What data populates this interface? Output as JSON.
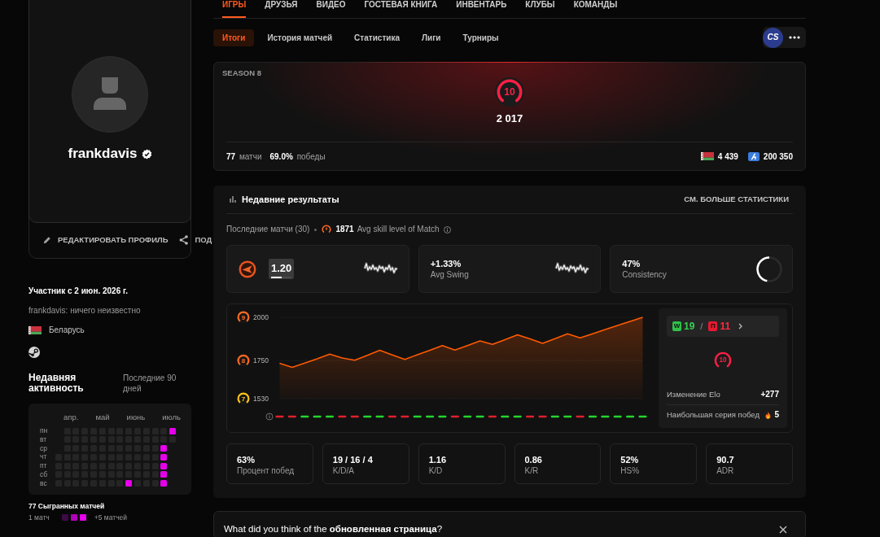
{
  "nav": [
    {
      "label": "ИГРЫ",
      "selected": true
    },
    {
      "label": "ДРУЗЬЯ",
      "selected": false
    },
    {
      "label": "ВИДЕО",
      "selected": false
    },
    {
      "label": "ГОСТЕВАЯ КНИГА",
      "selected": false
    },
    {
      "label": "ИНВЕНТАРЬ",
      "selected": false
    },
    {
      "label": "КЛУБЫ",
      "selected": false
    },
    {
      "label": "КОМАНДЫ",
      "selected": false
    }
  ],
  "profile": {
    "username": "frankdavis",
    "verified": true,
    "actions": [
      {
        "kind": "edit",
        "label": "РЕДАКТИРОВАТЬ ПРОФИЛЬ"
      },
      {
        "kind": "share",
        "label": "ПОД"
      }
    ]
  },
  "about": {
    "member_since": "Участник с 2 июн. 2026 г.",
    "bio": "frankdavis: ничего неизвестно",
    "country": "Беларусь"
  },
  "activity": {
    "title": "Недавняя активность",
    "period": "Последние 90 дней",
    "months": [
      "апр.",
      "май",
      "июнь",
      "июль"
    ],
    "rows": [
      {
        "day": "пн",
        "cells": [
          {
            "kind": "blank"
          },
          {
            "kind": "day",
            "active": false
          },
          {
            "kind": "day",
            "active": false
          },
          {
            "kind": "day",
            "active": false
          },
          {
            "kind": "day",
            "active": false
          },
          {
            "kind": "day",
            "active": false
          },
          {
            "kind": "day",
            "active": false
          },
          {
            "kind": "day",
            "active": false
          },
          {
            "kind": "day",
            "active": false
          },
          {
            "kind": "day",
            "active": false
          },
          {
            "kind": "day",
            "active": false
          },
          {
            "kind": "day",
            "active": false
          },
          {
            "kind": "day",
            "active": false
          },
          {
            "kind": "day",
            "active": true
          }
        ]
      },
      {
        "day": "вт",
        "cells": [
          {
            "kind": "blank"
          },
          {
            "kind": "day",
            "active": false
          },
          {
            "kind": "day",
            "active": false
          },
          {
            "kind": "day",
            "active": false
          },
          {
            "kind": "day",
            "active": false
          },
          {
            "kind": "day",
            "active": false
          },
          {
            "kind": "day",
            "active": false
          },
          {
            "kind": "day",
            "active": false
          },
          {
            "kind": "day",
            "active": false
          },
          {
            "kind": "day",
            "active": false
          },
          {
            "kind": "day",
            "active": false
          },
          {
            "kind": "day",
            "active": false
          },
          {
            "kind": "day",
            "active": false
          },
          {
            "kind": "day",
            "active": false
          }
        ]
      },
      {
        "day": "ср",
        "cells": [
          {
            "kind": "blank"
          },
          {
            "kind": "day",
            "active": false
          },
          {
            "kind": "day",
            "active": false
          },
          {
            "kind": "day",
            "active": false
          },
          {
            "kind": "day",
            "active": false
          },
          {
            "kind": "day",
            "active": false
          },
          {
            "kind": "day",
            "active": false
          },
          {
            "kind": "day",
            "active": false
          },
          {
            "kind": "day",
            "active": false
          },
          {
            "kind": "day",
            "active": false
          },
          {
            "kind": "day",
            "active": false
          },
          {
            "kind": "day",
            "active": false
          },
          {
            "kind": "day",
            "active": true
          },
          {
            "kind": "blank"
          }
        ]
      },
      {
        "day": "чт",
        "cells": [
          {
            "kind": "day",
            "active": false
          },
          {
            "kind": "day",
            "active": false
          },
          {
            "kind": "day",
            "active": false
          },
          {
            "kind": "day",
            "active": false
          },
          {
            "kind": "day",
            "active": false
          },
          {
            "kind": "day",
            "active": false
          },
          {
            "kind": "day",
            "active": false
          },
          {
            "kind": "day",
            "active": false
          },
          {
            "kind": "day",
            "active": false
          },
          {
            "kind": "day",
            "active": false
          },
          {
            "kind": "day",
            "active": false
          },
          {
            "kind": "day",
            "active": false
          },
          {
            "kind": "day",
            "active": true
          },
          {
            "kind": "blank"
          }
        ]
      },
      {
        "day": "пт",
        "cells": [
          {
            "kind": "day",
            "active": false
          },
          {
            "kind": "day",
            "active": false
          },
          {
            "kind": "day",
            "active": false
          },
          {
            "kind": "day",
            "active": false
          },
          {
            "kind": "day",
            "active": false
          },
          {
            "kind": "day",
            "active": false
          },
          {
            "kind": "day",
            "active": false
          },
          {
            "kind": "day",
            "active": false
          },
          {
            "kind": "day",
            "active": false
          },
          {
            "kind": "day",
            "active": false
          },
          {
            "kind": "day",
            "active": false
          },
          {
            "kind": "day",
            "active": false
          },
          {
            "kind": "day",
            "active": true
          },
          {
            "kind": "blank"
          }
        ]
      },
      {
        "day": "сб",
        "cells": [
          {
            "kind": "day",
            "active": false
          },
          {
            "kind": "day",
            "active": false
          },
          {
            "kind": "day",
            "active": false
          },
          {
            "kind": "day",
            "active": false
          },
          {
            "kind": "day",
            "active": false
          },
          {
            "kind": "day",
            "active": false
          },
          {
            "kind": "day",
            "active": false
          },
          {
            "kind": "day",
            "active": false
          },
          {
            "kind": "day",
            "active": false
          },
          {
            "kind": "day",
            "active": false
          },
          {
            "kind": "day",
            "active": false
          },
          {
            "kind": "day",
            "active": false
          },
          {
            "kind": "day",
            "active": true
          },
          {
            "kind": "blank"
          }
        ]
      },
      {
        "day": "вс",
        "cells": [
          {
            "kind": "day",
            "active": false
          },
          {
            "kind": "day",
            "active": false
          },
          {
            "kind": "day",
            "active": false
          },
          {
            "kind": "day",
            "active": false
          },
          {
            "kind": "day",
            "active": false
          },
          {
            "kind": "day",
            "active": false
          },
          {
            "kind": "day",
            "active": false
          },
          {
            "kind": "day",
            "active": false
          },
          {
            "kind": "day",
            "active": true
          },
          {
            "kind": "day",
            "active": false
          },
          {
            "kind": "day",
            "active": false
          },
          {
            "kind": "day",
            "active": false
          },
          {
            "kind": "day",
            "active": true
          },
          {
            "kind": "blank"
          }
        ]
      }
    ],
    "total": "77 Сыгранных матчей",
    "legend": {
      "min": "1 матч",
      "max": "+5 матчей",
      "swatches": [
        {
          "color": "#3c0a44"
        },
        {
          "color": "#b000b8"
        },
        {
          "color": "#e600eb"
        }
      ]
    }
  },
  "subtabs": [
    {
      "label": "Итоги",
      "selected": true
    },
    {
      "label": "История матчей",
      "selected": false
    },
    {
      "label": "Статистика",
      "selected": false
    },
    {
      "label": "Лиги",
      "selected": false
    },
    {
      "label": "Турниры",
      "selected": false
    }
  ],
  "game": {
    "label": "CS"
  },
  "season": {
    "title": "SEASON 8",
    "level": "10",
    "elo": "2 017",
    "stats": [
      "**77** матчи",
      "**69.0%** победы"
    ],
    "ranks": [
      {
        "kind": "country",
        "value": "4 439"
      },
      {
        "kind": "region",
        "value": "200 350"
      }
    ]
  },
  "recent": {
    "title": "Недавние результаты",
    "more_link": "СМ. БОЛЬШЕ СТАТИСТИКИ",
    "summary": {
      "label": "Последние матчи (30)",
      "avg_skill": "1871",
      "avg_skill_label": "Avg skill level of Match"
    },
    "tiles": [
      {
        "kind": "rating",
        "value": "1.20",
        "level": 0.5
      },
      {
        "kind": "sparkline",
        "value": "+1.33%",
        "label": "Avg Swing"
      },
      {
        "kind": "ring",
        "value": "47%",
        "label": "Consistency",
        "level": 0.47
      }
    ],
    "chart": {
      "chart_data": {
        "type": "area",
        "ylim": [
          1530,
          2000
        ],
        "yticks": [
          {
            "value": 2000,
            "label": "2000"
          },
          {
            "value": 1750,
            "label": "1750"
          },
          {
            "value": 1530,
            "label": "1530"
          }
        ],
        "values": [
          1735,
          1711,
          1736,
          1760,
          1787,
          1765,
          1752,
          1780,
          1809,
          1783,
          1757,
          1784,
          1810,
          1837,
          1811,
          1837,
          1863,
          1844,
          1871,
          1899,
          1875,
          1850,
          1877,
          1905,
          1881,
          1905,
          1929,
          1953,
          1977,
          2000
        ]
      },
      "tick_badges": [
        {
          "level": "9",
          "color": "#ff6a1f"
        },
        {
          "level": "8",
          "color": "#ff6a1f"
        },
        {
          "level": "7",
          "color": "#ffc21a"
        }
      ],
      "results": [
        {
          "won": false
        },
        {
          "won": false
        },
        {
          "won": true
        },
        {
          "won": true
        },
        {
          "won": true
        },
        {
          "won": false
        },
        {
          "won": false
        },
        {
          "won": true
        },
        {
          "won": true
        },
        {
          "won": false
        },
        {
          "won": false
        },
        {
          "won": true
        },
        {
          "won": true
        },
        {
          "won": true
        },
        {
          "won": false
        },
        {
          "won": true
        },
        {
          "won": true
        },
        {
          "won": false
        },
        {
          "won": true
        },
        {
          "won": true
        },
        {
          "won": false
        },
        {
          "won": false
        },
        {
          "won": true
        },
        {
          "won": true
        },
        {
          "won": false
        },
        {
          "won": true
        },
        {
          "won": true
        },
        {
          "won": true
        },
        {
          "won": true
        },
        {
          "won": true
        }
      ],
      "side": {
        "wins_mark": "W",
        "wins": "19",
        "separator": "/",
        "losses_mark": "П",
        "losses": "11",
        "level": "10",
        "elo_change_label": "Изменение Elo",
        "elo_change": "+277",
        "streak_label": "Наибольшая серия побед",
        "streak": "5"
      }
    },
    "stats": [
      {
        "value": "63%",
        "label": "Процент побед"
      },
      {
        "value": "19 / 16 / 4",
        "label": "K/D/A"
      },
      {
        "value": "1.16",
        "label": "K/D"
      },
      {
        "value": "0.86",
        "label": "K/R"
      },
      {
        "value": "52%",
        "label": "HS%"
      },
      {
        "value": "90.7",
        "label": "ADR"
      }
    ]
  },
  "feedback": {
    "text": "What did you think of the **обновленная страница**?"
  }
}
